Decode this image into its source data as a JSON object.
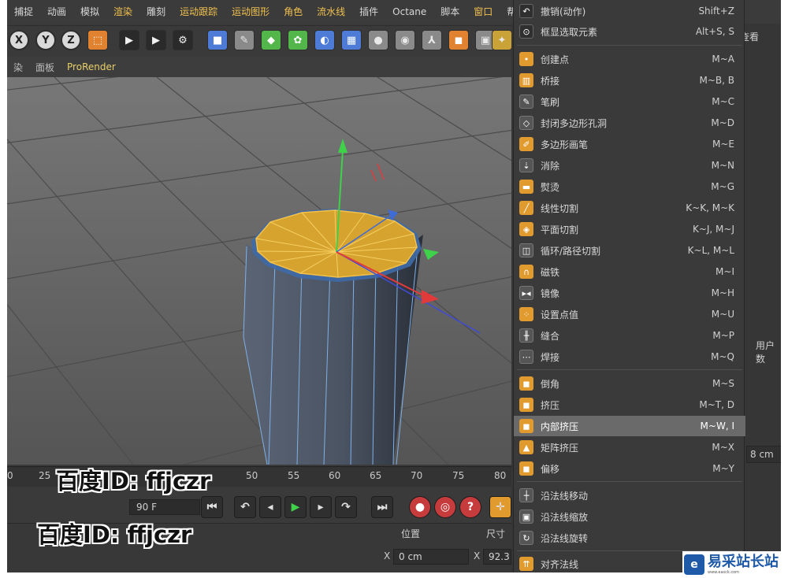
{
  "menubar": {
    "items": [
      "捕捉",
      "动画",
      "模拟",
      "渲染",
      "雕刻",
      "运动跟踪",
      "运动图形",
      "角色",
      "流水线",
      "插件",
      "Octane",
      "脚本",
      "窗口",
      "帮"
    ],
    "highlighted": [
      "渲染",
      "运动跟踪",
      "运动图形",
      "角色",
      "流水线",
      "窗口"
    ]
  },
  "toolbar": {
    "axis_x": "X",
    "axis_y": "Y",
    "axis_z": "Z",
    "icons": [
      "coordinate-system-icon",
      "render-view-icon",
      "render-picture-viewer-icon",
      "render-settings-icon",
      "cube-icon",
      "pen-icon",
      "subdivision-icon",
      "array-icon",
      "deformer-icon",
      "floor-icon",
      "camera-icon",
      "light-icon",
      "character-icon",
      "cloner-icon",
      "texture-icon",
      "light-bulb-icon"
    ]
  },
  "viewport_header": {
    "items": [
      "染",
      "面板",
      "ProRender"
    ]
  },
  "timeline": {
    "ticks": [
      "0",
      "25",
      "50",
      "55",
      "60",
      "65",
      "70",
      "75",
      "80"
    ],
    "frame_field": "90 F"
  },
  "coords": {
    "header_position": "位置",
    "header_size": "尺寸",
    "x_label": "X",
    "x_value": "0 cm",
    "x_label2": "X",
    "size_x_value": "92.3"
  },
  "side_panel": {
    "view_tab": "查看",
    "user_data": "用户数",
    "cm_value": "8 cm"
  },
  "context_menu": {
    "items": [
      {
        "label": "撤销(动作)",
        "shortcut": "Shift+Z",
        "icon": "undo-icon"
      },
      {
        "label": "框显选取元素",
        "shortcut": "Alt+S, S",
        "icon": "frame-selected-icon"
      },
      {
        "label": "创建点",
        "shortcut": "M~A",
        "icon": "create-point-icon"
      },
      {
        "label": "桥接",
        "shortcut": "M~B, B",
        "icon": "bridge-icon"
      },
      {
        "label": "笔刷",
        "shortcut": "M~C",
        "icon": "brush-icon"
      },
      {
        "label": "封闭多边形孔洞",
        "shortcut": "M~D",
        "icon": "close-hole-icon"
      },
      {
        "label": "多边形画笔",
        "shortcut": "M~E",
        "icon": "polygon-pen-icon"
      },
      {
        "label": "消除",
        "shortcut": "M~N",
        "icon": "dissolve-icon"
      },
      {
        "label": "熨烫",
        "shortcut": "M~G",
        "icon": "iron-icon"
      },
      {
        "label": "线性切割",
        "shortcut": "K~K, M~K",
        "icon": "line-cut-icon"
      },
      {
        "label": "平面切割",
        "shortcut": "K~J, M~J",
        "icon": "plane-cut-icon"
      },
      {
        "label": "循环/路径切割",
        "shortcut": "K~L, M~L",
        "icon": "loop-cut-icon"
      },
      {
        "label": "磁铁",
        "shortcut": "M~I",
        "icon": "magnet-icon"
      },
      {
        "label": "镜像",
        "shortcut": "M~H",
        "icon": "mirror-icon"
      },
      {
        "label": "设置点值",
        "shortcut": "M~U",
        "icon": "set-point-value-icon"
      },
      {
        "label": "缝合",
        "shortcut": "M~P",
        "icon": "stitch-icon"
      },
      {
        "label": "焊接",
        "shortcut": "M~Q",
        "icon": "weld-icon"
      },
      {
        "label": "倒角",
        "shortcut": "M~S",
        "icon": "bevel-icon"
      },
      {
        "label": "挤压",
        "shortcut": "M~T, D",
        "icon": "extrude-icon"
      },
      {
        "label": "内部挤压",
        "shortcut": "M~W, I",
        "icon": "extrude-inner-icon"
      },
      {
        "label": "矩阵挤压",
        "shortcut": "M~X",
        "icon": "matrix-extrude-icon"
      },
      {
        "label": "偏移",
        "shortcut": "M~Y",
        "icon": "smooth-shift-icon"
      },
      {
        "label": "沿法线移动",
        "shortcut": "",
        "icon": "normal-move-icon"
      },
      {
        "label": "沿法线缩放",
        "shortcut": "",
        "icon": "normal-scale-icon"
      },
      {
        "label": "沿法线旋转",
        "shortcut": "",
        "icon": "normal-rotate-icon"
      },
      {
        "label": "对齐法线",
        "shortcut": "",
        "icon": "align-normals-icon"
      }
    ],
    "selected": "内部挤压"
  },
  "watermark": {
    "line1": "百度ID: ffjczr",
    "line2": "百度ID: ffjczr"
  },
  "site_logo": {
    "name": "易采站长站",
    "sub": "www.easck.com"
  },
  "colors": {
    "accent_yellow": "#f2c14e",
    "cap_fill": "#d6a32e",
    "cylinder": "#4a5566",
    "selection_bg": "#6a6a6a"
  }
}
